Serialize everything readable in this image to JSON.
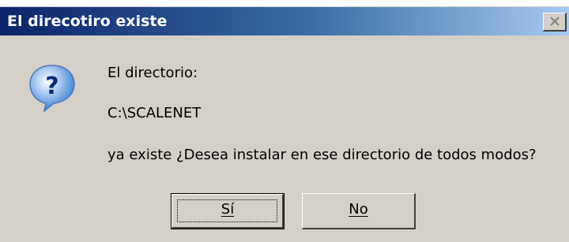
{
  "window": {
    "title": "El direcotiro existe",
    "close_icon": "close-icon"
  },
  "message": {
    "line1": "El directorio:",
    "line2": "C:\\SCALENET",
    "line3": "ya existe ¿Desea instalar en ese directorio de todos modos?",
    "icon": "question-icon"
  },
  "buttons": {
    "yes_label": "Sí",
    "no_label": "No"
  },
  "colors": {
    "titlebar_start": "#0a246a",
    "titlebar_end": "#a6caf0",
    "dialog_bg": "#d4d0c8",
    "icon_blue": "#3b7fd6"
  }
}
